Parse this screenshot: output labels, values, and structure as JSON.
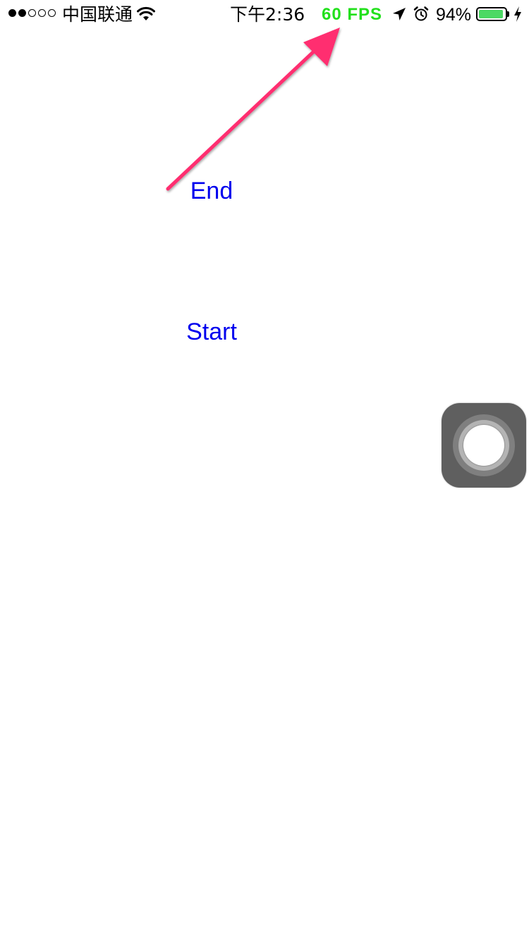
{
  "status_bar": {
    "signal_dots": [
      true,
      true,
      false,
      false,
      false
    ],
    "carrier": "中国联通",
    "wifi_icon": "wifi-icon",
    "time": "下午2:36",
    "fps": "60 FPS",
    "fps_color": "#22e01c",
    "location_icon": "location-arrow-icon",
    "alarm_icon": "alarm-clock-icon",
    "battery_percent": "94%",
    "battery_level": 0.94,
    "battery_color": "#4cd964",
    "charging_icon": "charging-bolt-icon"
  },
  "annotation": {
    "arrow_color": "#ff2d6f"
  },
  "main": {
    "end_label": "End",
    "start_label": "Start",
    "link_color": "#0000ee"
  },
  "assistive_touch": {
    "icon": "assistive-touch-icon"
  }
}
